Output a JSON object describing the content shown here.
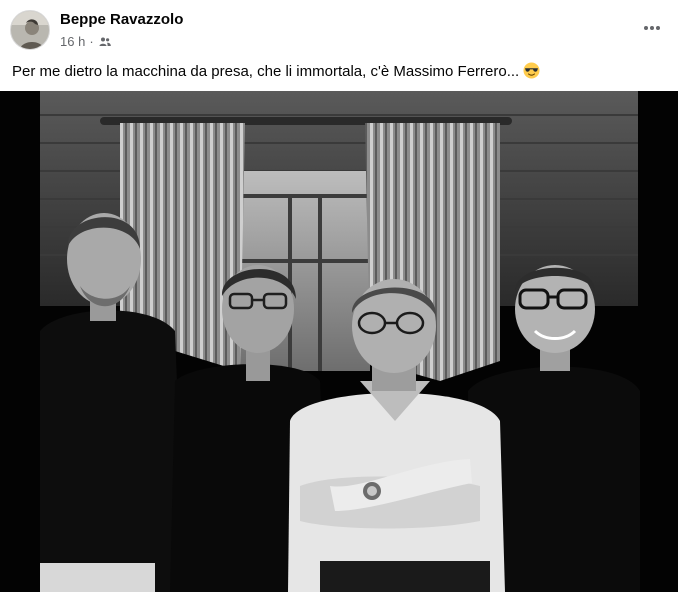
{
  "post": {
    "author": "Beppe Ravazzolo",
    "timestamp": "16 h",
    "separator": "·",
    "audience_icon": "friends-icon",
    "more_icon": "more-dots-icon",
    "caption": "Per me dietro la macchina da presa, che li immortala, c'è Massimo Ferrero...",
    "caption_emoji": "smiling-face-with-sunglasses-emoji",
    "photo": {
      "description_icon": "group-photo-four-men-black-and-white",
      "style": "black-and-white"
    }
  },
  "colors": {
    "text_primary": "#050505",
    "text_secondary": "#65676b",
    "background": "#ffffff",
    "emoji_yellow": "#ffcc4d"
  }
}
